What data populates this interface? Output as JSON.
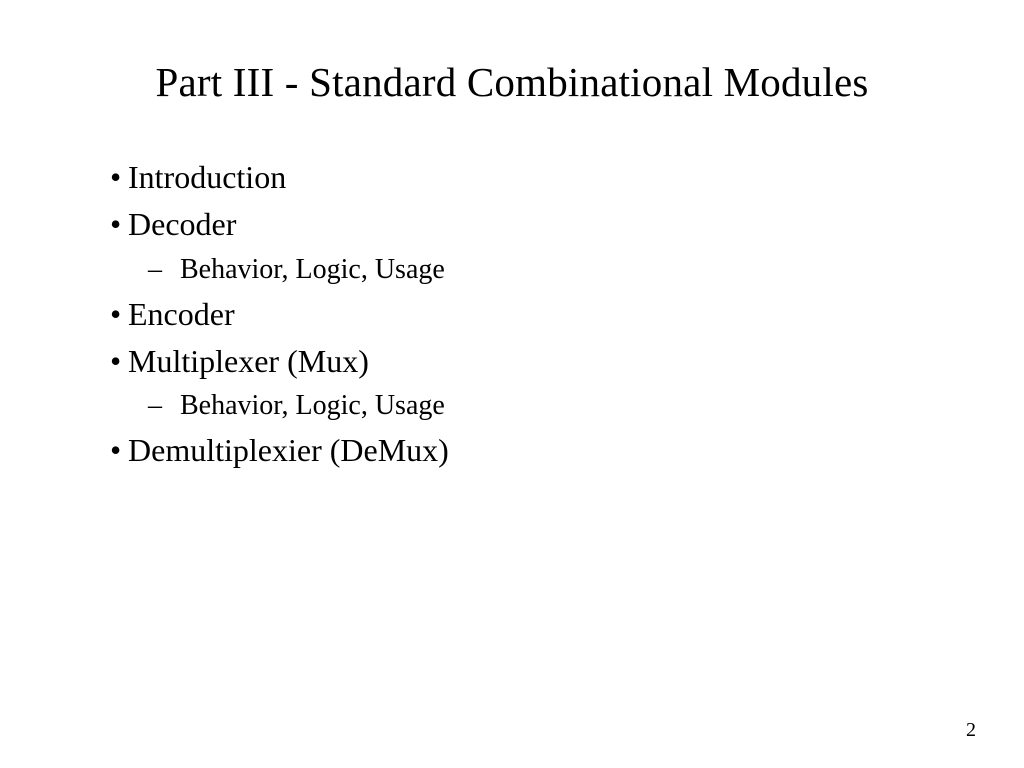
{
  "title": "Part III - Standard Combinational Modules",
  "items": [
    {
      "text": "Introduction",
      "level": 1
    },
    {
      "text": "Decoder",
      "level": 1
    },
    {
      "text": "Behavior, Logic, Usage",
      "level": 2
    },
    {
      "text": "Encoder",
      "level": 1
    },
    {
      "text": "Multiplexer (Mux)",
      "level": 1
    },
    {
      "text": "Behavior, Logic, Usage",
      "level": 2
    },
    {
      "text": "Demultiplexier (DeMux)",
      "level": 1
    }
  ],
  "page_number": "2"
}
